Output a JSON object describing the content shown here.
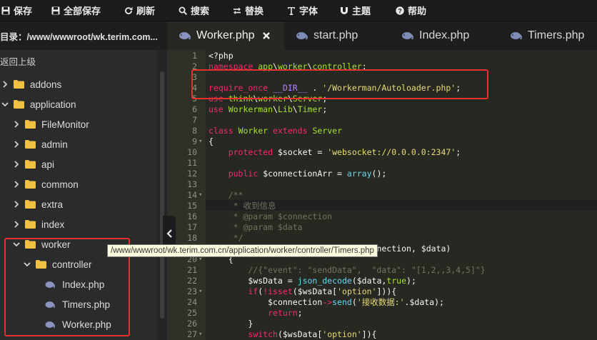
{
  "toolbar": {
    "buttons": [
      {
        "label": "保存",
        "icon": "save-icon"
      },
      {
        "label": "全部保存",
        "icon": "save-all-icon"
      },
      {
        "label": "刷新",
        "icon": "refresh-icon"
      },
      {
        "label": "搜索",
        "icon": "search-icon"
      },
      {
        "label": "替换",
        "icon": "replace-icon"
      },
      {
        "label": "字体",
        "icon": "font-icon"
      },
      {
        "label": "主题",
        "icon": "theme-icon"
      },
      {
        "label": "帮助",
        "icon": "help-icon"
      }
    ]
  },
  "sidebar": {
    "directory_label": "目录：/www/wwwroot/wk.terim.com...",
    "up_label": "返回上级",
    "tree": [
      {
        "label": "addons",
        "type": "folder",
        "depth": 0,
        "expanded": false
      },
      {
        "label": "application",
        "type": "folder",
        "depth": 0,
        "expanded": true
      },
      {
        "label": "FileMonitor",
        "type": "folder",
        "depth": 1,
        "expanded": false
      },
      {
        "label": "admin",
        "type": "folder",
        "depth": 1,
        "expanded": false
      },
      {
        "label": "api",
        "type": "folder",
        "depth": 1,
        "expanded": false
      },
      {
        "label": "common",
        "type": "folder",
        "depth": 1,
        "expanded": false
      },
      {
        "label": "extra",
        "type": "folder",
        "depth": 1,
        "expanded": false
      },
      {
        "label": "index",
        "type": "folder",
        "depth": 1,
        "expanded": false
      },
      {
        "label": "worker",
        "type": "folder",
        "depth": 1,
        "expanded": true
      },
      {
        "label": "controller",
        "type": "folder",
        "depth": 2,
        "expanded": true
      },
      {
        "label": "Index.php",
        "type": "file",
        "depth": 3
      },
      {
        "label": "Timers.php",
        "type": "file",
        "depth": 3
      },
      {
        "label": "Worker.php",
        "type": "file",
        "depth": 3
      }
    ]
  },
  "tabs": [
    {
      "label": "Worker.php",
      "active": true,
      "closable": true
    },
    {
      "label": "start.php",
      "active": false
    },
    {
      "label": "Index.php",
      "active": false
    },
    {
      "label": "Timers.php",
      "active": false
    }
  ],
  "tooltip": "/www/wwwroot/wk.terim.com.cn/application/worker/controller/Timers.php",
  "code_lines": [
    {
      "n": "1",
      "fold": "",
      "text": "<?php"
    },
    {
      "n": "2",
      "fold": "",
      "text": "namespace app\\worker\\controller;"
    },
    {
      "n": "3",
      "fold": "",
      "text": ""
    },
    {
      "n": "4",
      "fold": "",
      "text": "require_once __DIR__ . '/Workerman/Autoloader.php';"
    },
    {
      "n": "5",
      "fold": "",
      "text": "use think\\worker\\Server;"
    },
    {
      "n": "6",
      "fold": "",
      "text": "use Workerman\\Lib\\Timer;"
    },
    {
      "n": "7",
      "fold": "",
      "text": ""
    },
    {
      "n": "8",
      "fold": "",
      "text": "class Worker extends Server"
    },
    {
      "n": "9",
      "fold": "▾",
      "text": "{"
    },
    {
      "n": "10",
      "fold": "",
      "text": "    protected $socket = 'websocket://0.0.0.0:2347';"
    },
    {
      "n": "11",
      "fold": "",
      "text": ""
    },
    {
      "n": "12",
      "fold": "",
      "text": "    public $connectionArr = array();"
    },
    {
      "n": "13",
      "fold": "",
      "text": ""
    },
    {
      "n": "14",
      "fold": "▾",
      "text": "    /**"
    },
    {
      "n": "15",
      "fold": "",
      "text": "     * 收到信息"
    },
    {
      "n": "16",
      "fold": "",
      "text": "     * @param $connection"
    },
    {
      "n": "17",
      "fold": "",
      "text": "     * @param $data"
    },
    {
      "n": "18",
      "fold": "",
      "text": "     */"
    },
    {
      "n": "19",
      "fold": "▾",
      "text": "    public function onMessage($connection, $data)"
    },
    {
      "n": "20",
      "fold": "▾",
      "text": "    {"
    },
    {
      "n": "21",
      "fold": "",
      "text": "        //{\"event\": \"sendData\",  \"data\": \"[1,2,,3,4,5]\"}"
    },
    {
      "n": "22",
      "fold": "",
      "text": "        $wsData = json_decode($data,true);"
    },
    {
      "n": "23",
      "fold": "▾",
      "text": "        if(!isset($wsData['option'])){"
    },
    {
      "n": "24",
      "fold": "",
      "text": "            $connection->send('接收数据:'.$data);"
    },
    {
      "n": "25",
      "fold": "",
      "text": "            return;"
    },
    {
      "n": "26",
      "fold": "",
      "text": "        }"
    },
    {
      "n": "27",
      "fold": "▾",
      "text": "        switch($wsData['option']){"
    }
  ]
}
